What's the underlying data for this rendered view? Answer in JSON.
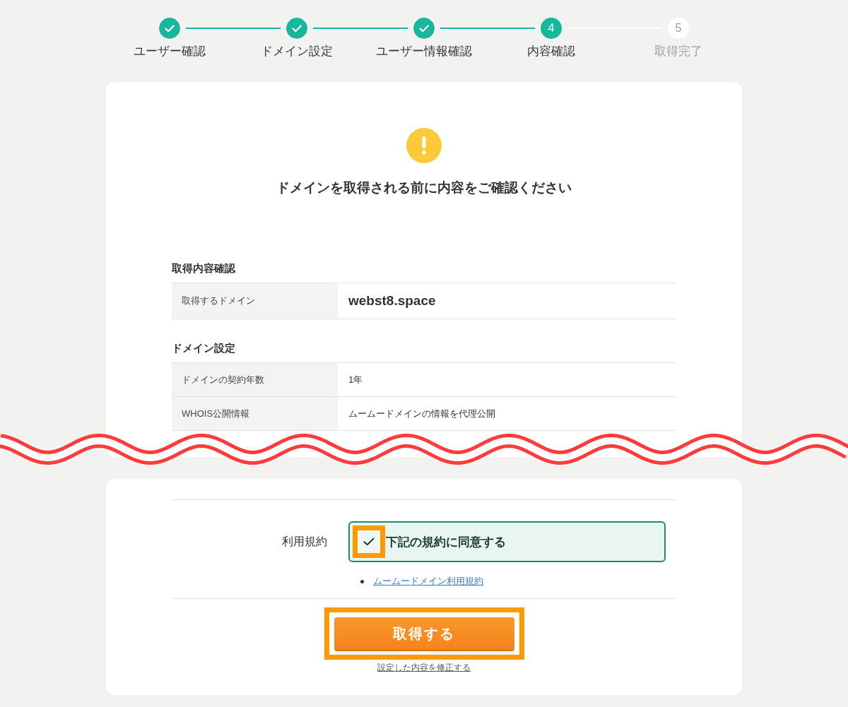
{
  "steps": [
    {
      "label": "ユーザー確認",
      "completed": true,
      "selected": false
    },
    {
      "label": "ドメイン設定",
      "completed": true,
      "selected": false
    },
    {
      "label": "ユーザー情報確認",
      "completed": true,
      "selected": false
    },
    {
      "label": "内容確認",
      "number": "4",
      "completed": false,
      "selected": true
    },
    {
      "label": "取得完了",
      "number": "5",
      "completed": false,
      "selected": false
    }
  ],
  "notice": {
    "heading": "ドメインを取得される前に内容をご確認ください"
  },
  "sections": [
    {
      "title": "取得内容確認",
      "rows": [
        {
          "label": "取得するドメイン",
          "value": "webst8.space",
          "kind": "domain"
        }
      ]
    },
    {
      "title": "ドメイン設定",
      "rows": [
        {
          "label": "ドメインの契約年数",
          "value": "1年",
          "kind": "plain"
        },
        {
          "label": "WHOIS公開情報",
          "value": "ムームードメインの情報を代理公開",
          "kind": "plain"
        }
      ]
    }
  ],
  "terms": {
    "label": "利用規約",
    "agree": {
      "label": "下記の規約に同意する",
      "checked": true,
      "highlighted": true
    },
    "links": [
      "ムームードメイン利用規約"
    ]
  },
  "submit": {
    "label": "取得する",
    "highlighted": true
  },
  "edit_link": "設定した内容を修正する"
}
